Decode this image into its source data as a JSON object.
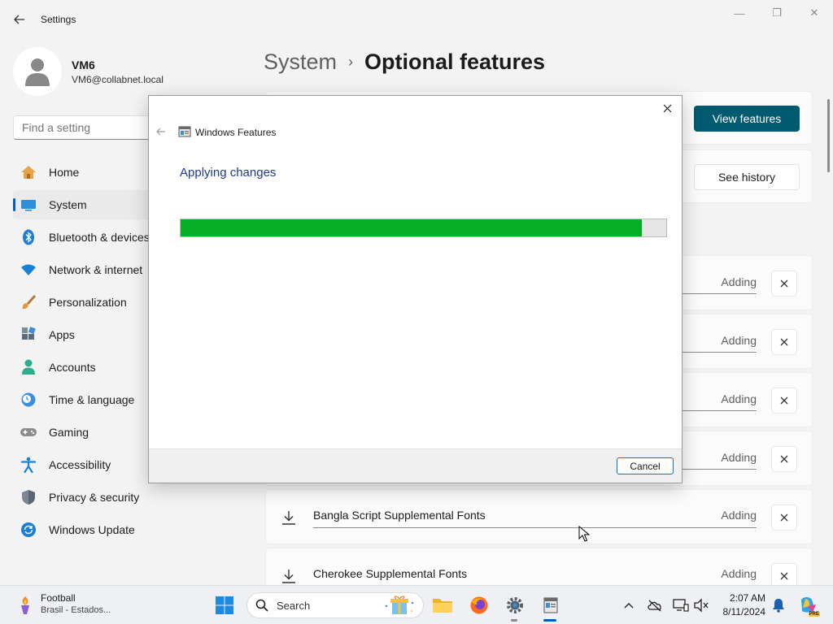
{
  "window": {
    "title": "Settings",
    "controls": {
      "minimize": "—",
      "maximize": "❐",
      "close": "✕"
    }
  },
  "profile": {
    "name": "VM6",
    "email": "VM6@collabnet.local"
  },
  "search": {
    "placeholder": "Find a setting"
  },
  "nav": {
    "items": [
      {
        "label": "Home",
        "icon": "home-icon"
      },
      {
        "label": "System",
        "icon": "system-icon",
        "active": true
      },
      {
        "label": "Bluetooth & devices",
        "icon": "bluetooth-icon"
      },
      {
        "label": "Network & internet",
        "icon": "wifi-icon"
      },
      {
        "label": "Personalization",
        "icon": "brush-icon"
      },
      {
        "label": "Apps",
        "icon": "apps-icon"
      },
      {
        "label": "Accounts",
        "icon": "accounts-icon"
      },
      {
        "label": "Time & language",
        "icon": "clock-globe-icon"
      },
      {
        "label": "Gaming",
        "icon": "gamepad-icon"
      },
      {
        "label": "Accessibility",
        "icon": "accessibility-icon"
      },
      {
        "label": "Privacy & security",
        "icon": "shield-icon"
      },
      {
        "label": "Windows Update",
        "icon": "update-icon"
      }
    ]
  },
  "breadcrumb": {
    "parent": "System",
    "separator": "›",
    "current": "Optional features"
  },
  "actions": {
    "view_features": "View features",
    "see_history": "See history"
  },
  "features": {
    "status_label": "Adding",
    "items": [
      {
        "name": ""
      },
      {
        "name": ""
      },
      {
        "name": ""
      },
      {
        "name": ""
      },
      {
        "name": "Bangla Script Supplemental Fonts"
      },
      {
        "name": "Cherokee Supplemental Fonts"
      }
    ]
  },
  "dialog": {
    "title": "Windows Features",
    "heading": "Applying changes",
    "progress": 0.95,
    "cancel": "Cancel",
    "colors": {
      "progress_fill": "#06b025",
      "heading": "#1e3a8a"
    }
  },
  "taskbar": {
    "weather_title": "Football",
    "weather_sub": "Brasil - Estados...",
    "search_label": "Search",
    "clock_time": "2:07 AM",
    "clock_date": "8/11/2024",
    "copilot_badge": "PRE"
  },
  "colors": {
    "accent": "#005fb8",
    "accent_button": "#005a70"
  }
}
